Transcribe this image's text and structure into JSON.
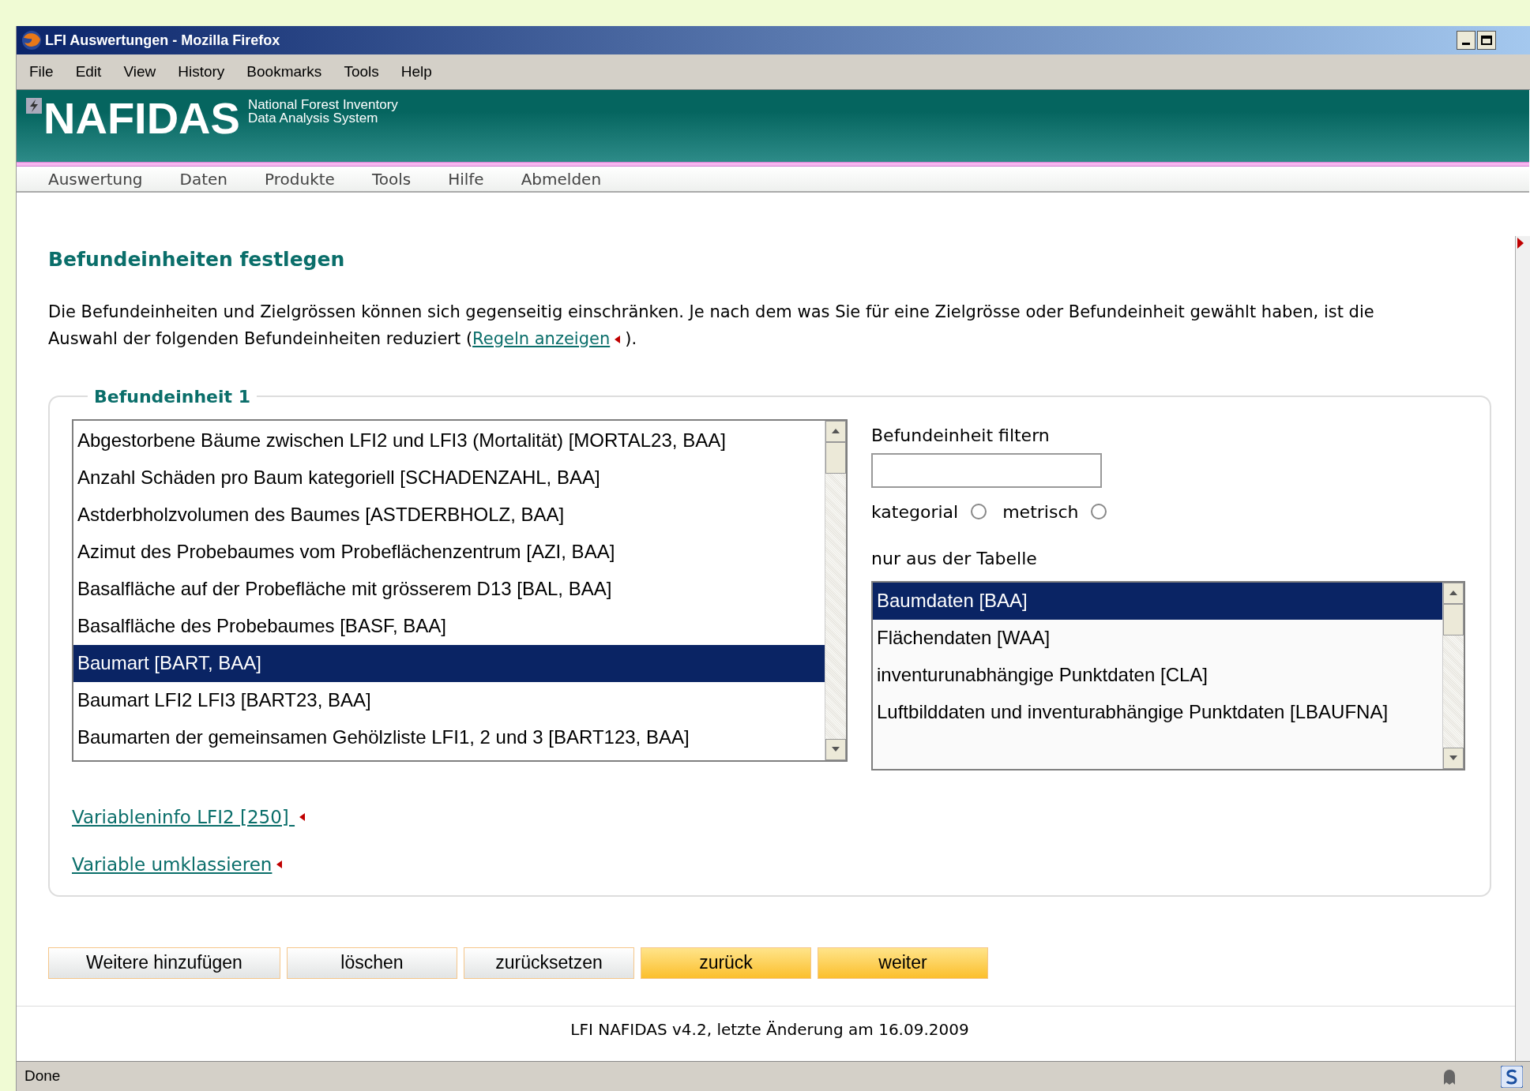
{
  "window": {
    "title": "LFI Auswertungen - Mozilla Firefox"
  },
  "menu": [
    "File",
    "Edit",
    "View",
    "History",
    "Bookmarks",
    "Tools",
    "Help"
  ],
  "banner": {
    "logo": "NAFIDAS",
    "subtitle_1": "National Forest Inventory",
    "subtitle_2": "Data Analysis System"
  },
  "nav": [
    "Auswertung",
    "Daten",
    "Produkte",
    "Tools",
    "Hilfe",
    "Abmelden"
  ],
  "heading": "Befundeinheiten festlegen",
  "intro": {
    "text": "Die Befundeinheiten und Zielgrössen können sich gegenseitig einschränken. Je nach dem was Sie für eine Zielgrösse oder Befundeinheit gewählt haben, ist die Auswahl der folgenden Befundeinheiten reduziert (",
    "link": "Regeln anzeigen",
    "after": ")."
  },
  "fieldset": {
    "legend": "Befundeinheit 1",
    "units": [
      {
        "label": "Abgestorbene Bäume zwischen LFI2 und LFI3 (Mortalität) [MORTAL23, BAA]",
        "selected": false
      },
      {
        "label": "Anzahl Schäden pro Baum kategoriell [SCHADENZAHL, BAA]",
        "selected": false
      },
      {
        "label": "Astderbholzvolumen des Baumes [ASTDERBHOLZ, BAA]",
        "selected": false
      },
      {
        "label": "Azimut des Probebaumes vom Probeflächenzentrum [AZI, BAA]",
        "selected": false
      },
      {
        "label": "Basalfläche auf der Probefläche mit grösserem D13 [BAL, BAA]",
        "selected": false
      },
      {
        "label": "Basalfläche des Probebaumes [BASF, BAA]",
        "selected": false
      },
      {
        "label": "Baumart [BART, BAA]",
        "selected": true
      },
      {
        "label": "Baumart LFI2 LFI3 [BART23, BAA]",
        "selected": false
      },
      {
        "label": "Baumarten der gemeinsamen Gehölzliste LFI1, 2 und 3 [BART123, BAA]",
        "selected": false
      }
    ],
    "filter_label": "Befundeinheit filtern",
    "radios": [
      {
        "label": "kategorial",
        "selected": false
      },
      {
        "label": "metrisch",
        "selected": false
      }
    ],
    "table_label": "nur aus der Tabelle",
    "tables": [
      {
        "label": "Baumdaten [BAA]",
        "selected": true
      },
      {
        "label": "Flächendaten [WAA]",
        "selected": false
      },
      {
        "label": "inventurunabhängige Punktdaten [CLA]",
        "selected": false
      },
      {
        "label": "Luftbilddaten und inventurabhängige Punktdaten [LBAUFNA]",
        "selected": false
      }
    ],
    "links": [
      "Variableninfo LFI2 [250] ",
      "Variable umklassieren"
    ]
  },
  "buttons": [
    {
      "label": "Weitere hinzufügen",
      "kind": "plain"
    },
    {
      "label": "löschen",
      "kind": "plain"
    },
    {
      "label": "zurücksetzen",
      "kind": "plain"
    },
    {
      "label": "zurück",
      "kind": "primary"
    },
    {
      "label": "weiter",
      "kind": "primary"
    }
  ],
  "footer": "LFI NAFIDAS v4.2, letzte Änderung am 16.09.2009",
  "status_bar": {
    "text": "Done"
  }
}
